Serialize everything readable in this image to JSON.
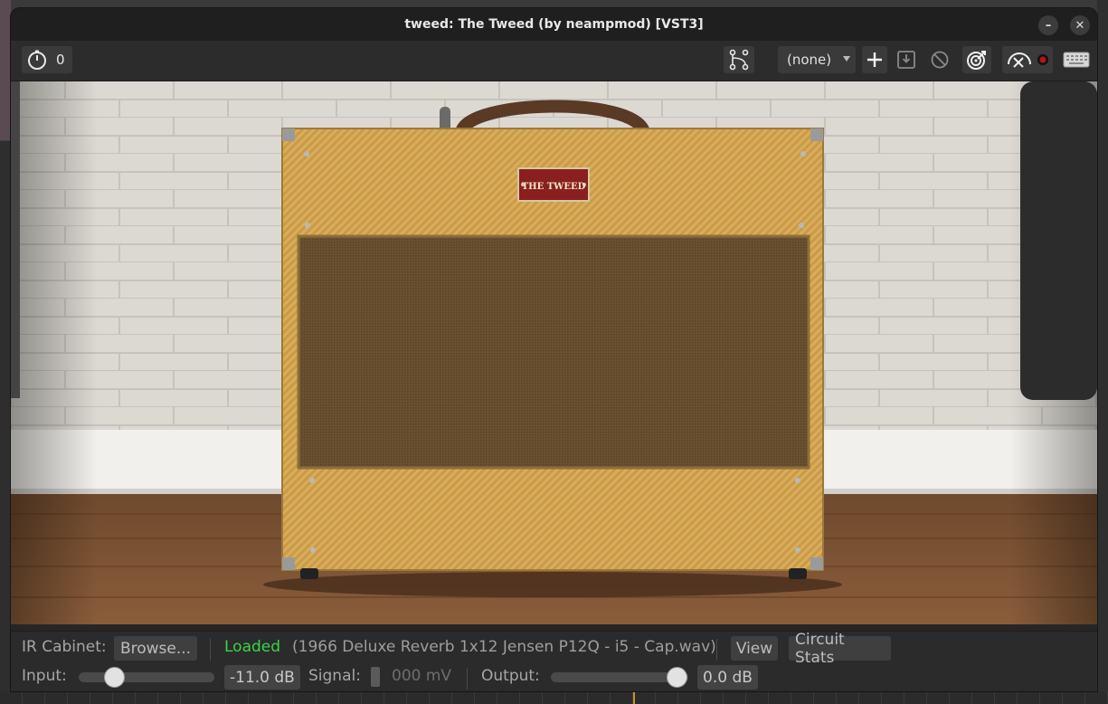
{
  "window": {
    "title": "tweed: The Tweed (by neampmod) [VST3]",
    "minimize_glyph": "–",
    "close_glyph": "✕"
  },
  "toolbar": {
    "cpu_value": "0",
    "preset": "(none)"
  },
  "amp": {
    "badge_text": "THE TWEED"
  },
  "ir": {
    "label": "IR Cabinet:",
    "browse": "Browse...",
    "status": "Loaded",
    "file": "(1966 Deluxe Reverb 1x12 Jensen P12Q - i5 - Cap.wav)",
    "view": "View",
    "circuit_stats": "Circuit Stats"
  },
  "levels": {
    "input_label": "Input:",
    "input_value": "-11.0 dB",
    "signal_label": "Signal:",
    "signal_value": "000 mV",
    "output_label": "Output:",
    "output_value": "0.0 dB"
  },
  "colors": {
    "loaded_status": "#39d44a",
    "tweed": "#d9ad5c",
    "grille_cloth": "#6a5130",
    "badge": "#8a1f1f"
  }
}
